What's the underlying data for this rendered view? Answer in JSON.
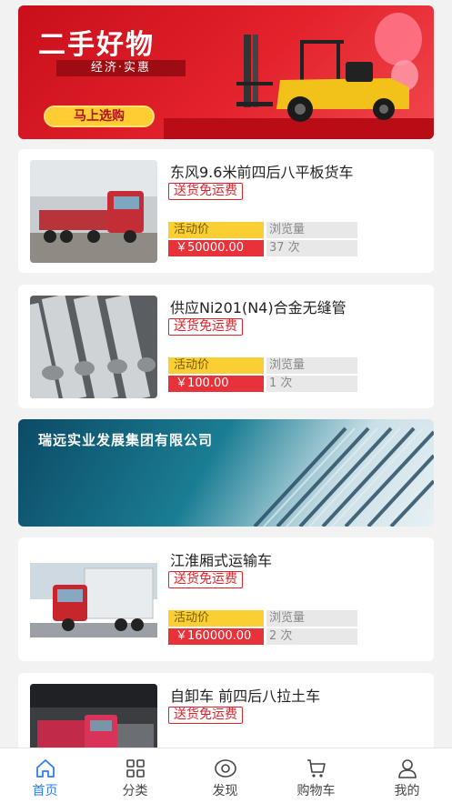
{
  "top_banner": {
    "title": "二手好物",
    "subtitle": "经济·实惠",
    "cta_label": "马上选购"
  },
  "products": [
    {
      "name": "东风9.6米前四后八平板货车",
      "tag": "送货免运费",
      "price_label": "活动价",
      "views_label": "浏览量",
      "price": "￥50000.00",
      "views": "37 次"
    },
    {
      "name": "供应Ni201(N4)合金无缝管",
      "tag": "送货免运费",
      "price_label": "活动价",
      "views_label": "浏览量",
      "price": "￥100.00",
      "views": "1 次"
    },
    {
      "name": "江淮厢式运输车",
      "tag": "送货免运费",
      "price_label": "活动价",
      "views_label": "浏览量",
      "price": "￥160000.00",
      "views": "2 次"
    },
    {
      "name": "自卸车 前四后八拉土车",
      "tag": "送货免运费"
    }
  ],
  "company_banner": {
    "name": "瑞远实业发展集团有限公司"
  },
  "tabbar": {
    "active": "home",
    "items": [
      {
        "key": "home",
        "label": "首页",
        "icon": "home-icon"
      },
      {
        "key": "category",
        "label": "分类",
        "icon": "grid-icon"
      },
      {
        "key": "discover",
        "label": "发现",
        "icon": "eye-icon"
      },
      {
        "key": "cart",
        "label": "购物车",
        "icon": "cart-icon"
      },
      {
        "key": "mine",
        "label": "我的",
        "icon": "user-icon"
      }
    ]
  },
  "colors": {
    "accent_red": "#e0232b",
    "price_bg": "#e8323a",
    "label_yellow": "#f9cf33",
    "tab_active": "#2f7ef0"
  }
}
